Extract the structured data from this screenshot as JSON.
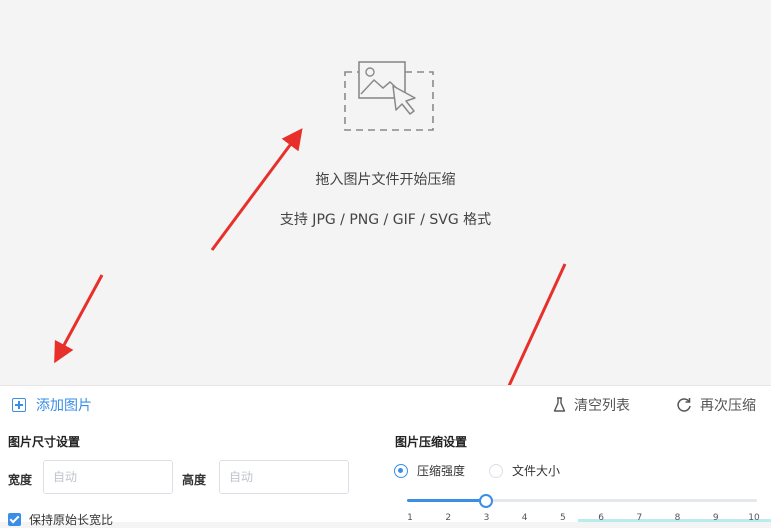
{
  "dropzone": {
    "icon": "image-drop-icon",
    "title": "拖入图片文件开始压缩",
    "subtitle": "支持 JPG / PNG / GIF / SVG 格式"
  },
  "toolbar": {
    "add_label": "添加图片",
    "clear_label": "清空列表",
    "recompress_label": "再次压缩"
  },
  "size_settings": {
    "title": "图片尺寸设置",
    "width_label": "宽度",
    "width_placeholder": "自动",
    "height_label": "高度",
    "height_placeholder": "自动",
    "keep_ratio_label": "保持原始长宽比",
    "keep_ratio_checked": true
  },
  "compress_settings": {
    "title": "图片压缩设置",
    "mode_options": [
      "压缩强度",
      "文件大小"
    ],
    "selected_mode": "压缩强度",
    "strength_scale": [
      "1",
      "2",
      "3",
      "4",
      "5",
      "6",
      "7",
      "8",
      "9",
      "10"
    ],
    "strength_value": 3
  },
  "colors": {
    "accent": "#3a8ee6",
    "annotation_arrow": "#e8302a"
  }
}
